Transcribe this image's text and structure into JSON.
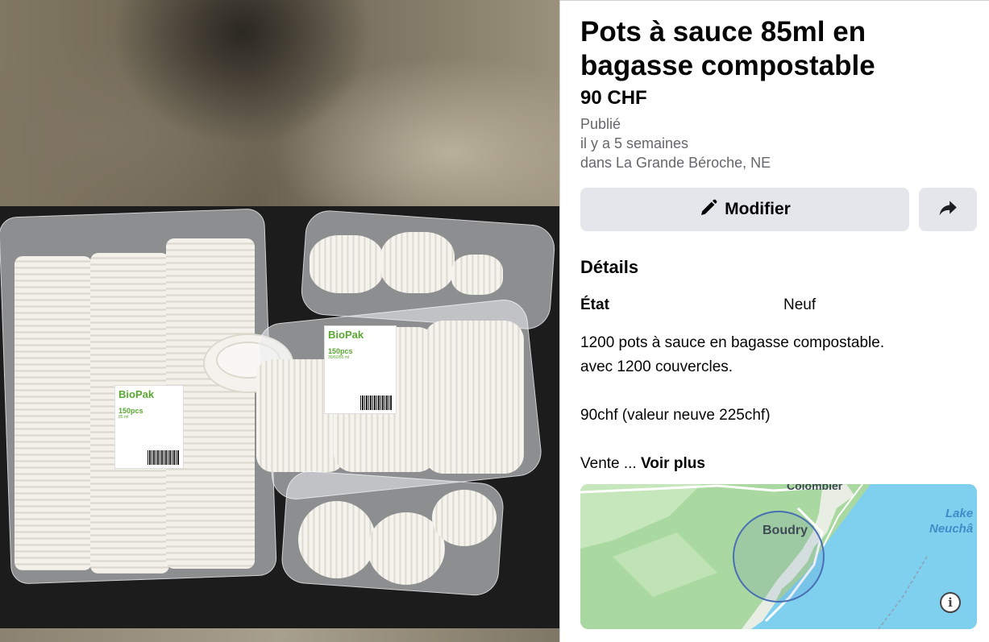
{
  "listing": {
    "title": "Pots à sauce 85ml en bagasse compostable",
    "price": "90 CHF",
    "published_label": "Publié",
    "published_time": "il y a 5 semaines",
    "published_place": "dans La Grande Béroche, NE"
  },
  "actions": {
    "edit_label": "Modifier",
    "edit_icon": "pencil-icon",
    "share_icon": "share-arrow-icon"
  },
  "details": {
    "heading": "Détails",
    "condition_label": "État",
    "condition_value": "Neuf",
    "description_lines": [
      "1200 pots à sauce en bagasse compostable.",
      "avec 1200 couvercles.",
      "90chf (valeur neuve 225chf)"
    ],
    "truncated_text": "Vente ...",
    "see_more_label": "Voir plus"
  },
  "map": {
    "labels": {
      "colombier": "Colombier",
      "boudry": "Boudry",
      "lake_line1": "Lake",
      "lake_line2": "Neuchâ"
    },
    "info_icon": "info-icon",
    "colors": {
      "land": "#a9d8a0",
      "water": "#7fd0ef",
      "radius": "#4a6fb5"
    }
  },
  "photo": {
    "label_brand": "BioPak",
    "label_count_1": "150pcs",
    "label_count_2": "150pcs",
    "label_size_1": "85 ml",
    "label_size_2": "30/60/85 ml"
  }
}
